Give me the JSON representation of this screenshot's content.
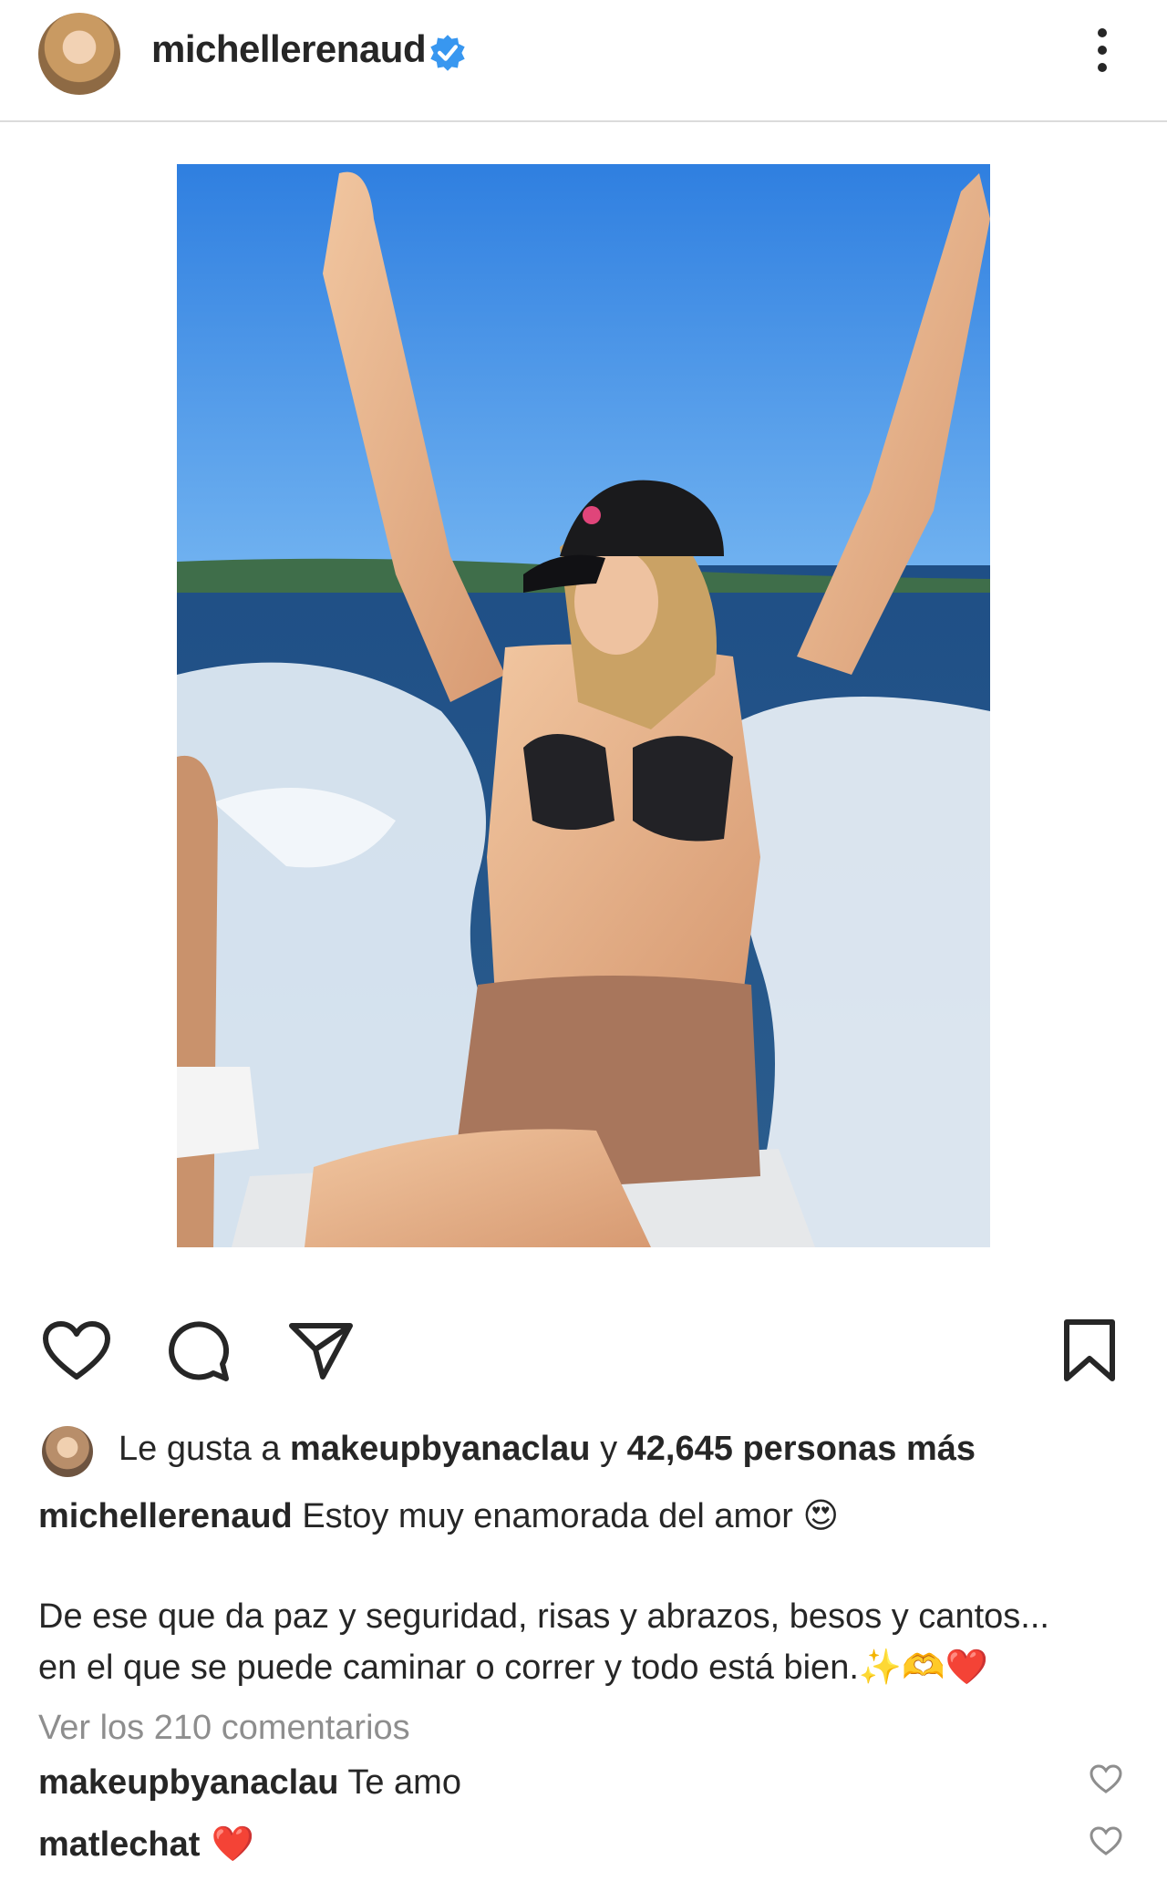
{
  "header": {
    "username": "michellerenaud",
    "verified": true
  },
  "post": {
    "image_alt": "Woman in black cap and bikini with arms raised on a boat, sea wake and blue sky behind"
  },
  "actions": {
    "like_icon": "heart-icon",
    "comment_icon": "comment-icon",
    "share_icon": "paper-plane-icon",
    "save_icon": "bookmark-icon"
  },
  "likes": {
    "prefix": "Le gusta a ",
    "user": "makeupbyanaclau",
    "middle": " y ",
    "count_text": "42,645 personas más"
  },
  "caption": {
    "username": "michellerenaud",
    "line1": " Estoy muy enamorada del amor ",
    "line1_emoji": "😍",
    "line2": "De ese que da paz y seguridad, risas y abrazos, besos y cantos...",
    "line3": "en el que se puede caminar o correr y todo está bien.",
    "line3_emoji": "✨🫶❤️"
  },
  "view_comments": "Ver los 210 comentarios",
  "comments": [
    {
      "username": "makeupbyanaclau",
      "text": " Te amo"
    },
    {
      "username": "matlechat",
      "text": " ❤️"
    }
  ],
  "colors": {
    "verified_blue": "#3897f0",
    "text": "#262626",
    "muted": "#8e8e8e"
  }
}
